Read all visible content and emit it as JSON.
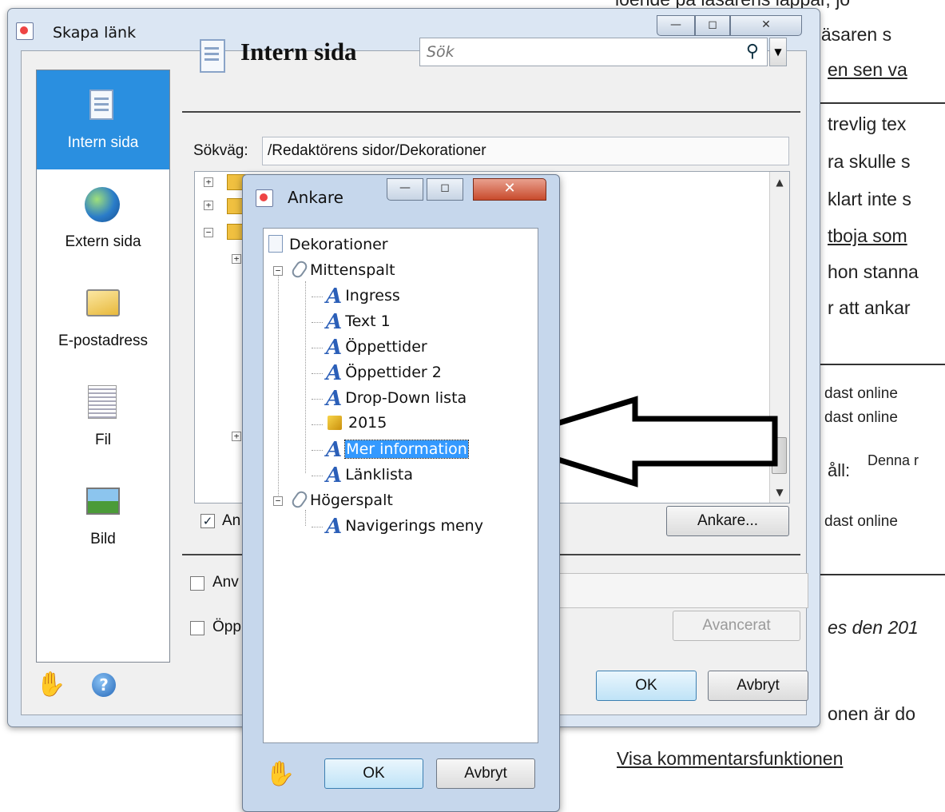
{
  "background_page": {
    "lines": [
      "loende på läsarens lappar, jo",
      "t läsaren s",
      "en sen va",
      "trevlig tex",
      "ra skulle s",
      "klart inte s",
      "tboja som",
      "hon stanna",
      "r att ankar"
    ],
    "small_lines": [
      "dast online",
      "dast online",
      "åll:",
      "Denna r",
      "dast online"
    ],
    "italic_line": "es den 201",
    "line_2": "onen är do",
    "link": "Visa kommentarsfunktionen"
  },
  "main_dialog": {
    "title": "Skapa länk",
    "window_buttons": {
      "minimize": "—",
      "maximize": "◻",
      "close": "✕"
    },
    "sidebar": {
      "items": [
        {
          "label": "Intern sida",
          "icon": "internal-page-icon"
        },
        {
          "label": "Extern sida",
          "icon": "globe-icon"
        },
        {
          "label": "E-postadress",
          "icon": "email-icon"
        },
        {
          "label": "Fil",
          "icon": "file-icon"
        },
        {
          "label": "Bild",
          "icon": "image-icon"
        }
      ],
      "active_index": 0
    },
    "header": {
      "title": "Intern sida"
    },
    "search": {
      "placeholder": "Sök"
    },
    "path": {
      "label": "Sökväg:",
      "value": "/Redaktörens sidor/Dekorationer"
    },
    "checkbox_1": {
      "label": "An",
      "checked": true
    },
    "ankare_button": "Ankare...",
    "checkbox_2": {
      "label": "Anv",
      "checked": false
    },
    "checkbox_3": {
      "label": "Öpp",
      "checked": false
    },
    "advanced_button": "Avancerat",
    "ok_button": "OK",
    "cancel_button": "Avbryt"
  },
  "anchor_dialog": {
    "title": "Ankare",
    "window_buttons": {
      "minimize": "—",
      "maximize": "◻",
      "close": "✕"
    },
    "tree": {
      "root": "Dekorationer",
      "group_1": "Mittenspalt",
      "items_1": [
        "Ingress",
        "Text 1",
        "Öppettider",
        "Öppettider 2",
        "Drop-Down lista",
        "2015",
        "Mer information",
        "Länklista"
      ],
      "selected": "Mer information",
      "group_2": "Högerspalt",
      "items_2": [
        "Navigerings meny"
      ]
    },
    "ok_button": "OK",
    "cancel_button": "Avbryt"
  }
}
